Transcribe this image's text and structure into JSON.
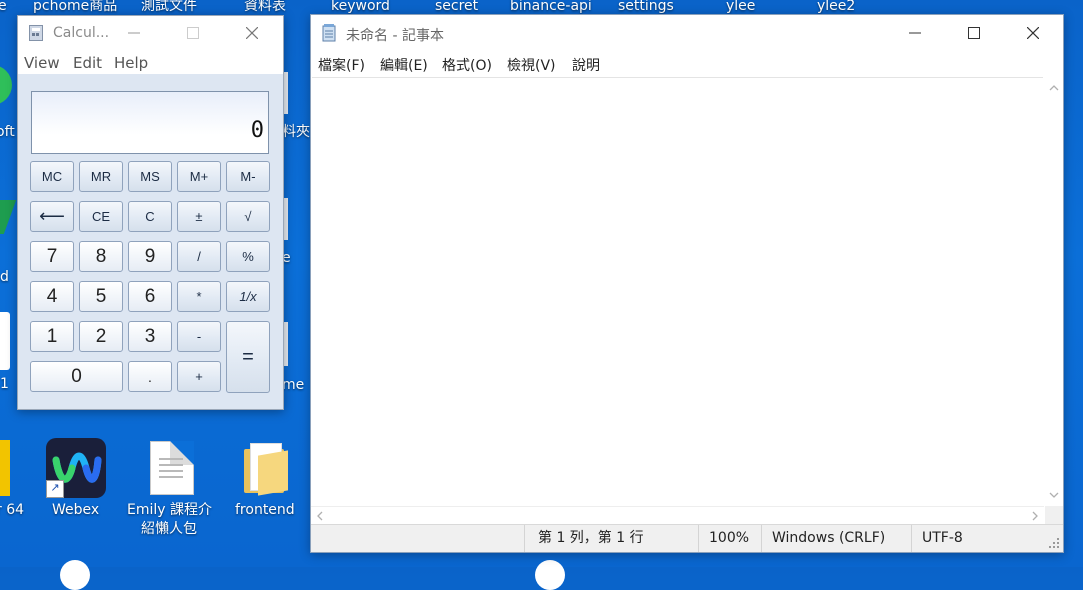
{
  "desktop": {
    "top_labels": [
      "pchome商品",
      "測試文件",
      "資料表",
      "keyword",
      "secret",
      "binance-api",
      "settings",
      "ylee",
      "ylee2"
    ],
    "partial_labels": [
      "e",
      "oft",
      "d",
      "1",
      "r 64",
      "料夾",
      "e",
      "me"
    ],
    "icons": [
      {
        "label": "Webex",
        "icon": "webex-icon"
      },
      {
        "label1": "Emily 課程介",
        "label2": "紹懶人包",
        "icon": "document-icon"
      },
      {
        "label": "frontend",
        "icon": "folder-icon"
      }
    ]
  },
  "calculator": {
    "title": "Calcul...",
    "menu": [
      "View",
      "Edit",
      "Help"
    ],
    "display_value": "0",
    "memory_row": [
      "MC",
      "MR",
      "MS",
      "M+",
      "M-"
    ],
    "row2": [
      "⟵",
      "CE",
      "C",
      "±",
      "√"
    ],
    "row3": [
      "7",
      "8",
      "9",
      "/",
      "%"
    ],
    "row4": [
      "4",
      "5",
      "6",
      "*",
      "1/x"
    ],
    "row5": [
      "1",
      "2",
      "3",
      "-"
    ],
    "row6": [
      "0",
      ".",
      "+"
    ],
    "equals": "="
  },
  "notepad": {
    "title": "未命名 - 記事本",
    "menu": [
      "檔案(F)",
      "編輯(E)",
      "格式(O)",
      "檢視(V)",
      "說明"
    ],
    "status": {
      "position": "第 1 列，第 1 行",
      "zoom": "100%",
      "line_ending": "Windows (CRLF)",
      "encoding": "UTF-8"
    }
  },
  "colors": {
    "desktop_bg": "#0b6fd8",
    "calc_body": "#dde6f2",
    "webex_bg": "#1a1f3a"
  }
}
